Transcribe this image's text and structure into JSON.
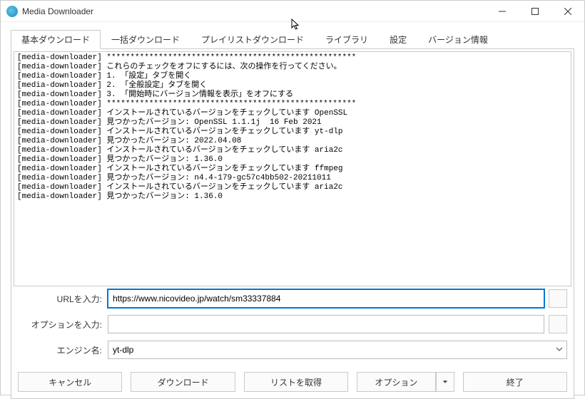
{
  "window": {
    "title": "Media Downloader"
  },
  "tabs": {
    "t0": "基本ダウンロード",
    "t1": "一括ダウンロード",
    "t2": "プレイリストダウンロード",
    "t3": "ライブラリ",
    "t4": "設定",
    "t5": "バージョン情報"
  },
  "log_lines": [
    "[media-downloader] *****************************************************",
    "[media-downloader] これらのチェックをオフにするには、次の操作を行ってください。",
    "[media-downloader] 1. 「設定」タブを開く",
    "[media-downloader] 2. 「全般設定」タブを開く",
    "[media-downloader] 3. 「開始時にバージョン情報を表示」をオフにする",
    "[media-downloader] *****************************************************",
    "[media-downloader] インストールされているバージョンをチェックしています OpenSSL",
    "[media-downloader] 見つかったバージョン: OpenSSL 1.1.1j  16 Feb 2021",
    "[media-downloader] インストールされているバージョンをチェックしています yt-dlp",
    "[media-downloader] 見つかったバージョン: 2022.04.08",
    "[media-downloader] インストールされているバージョンをチェックしています aria2c",
    "[media-downloader] 見つかったバージョン: 1.36.0",
    "[media-downloader] インストールされているバージョンをチェックしています ffmpeg",
    "[media-downloader] 見つかったバージョン: n4.4-179-gc57c4bb502-20211011",
    "[media-downloader] インストールされているバージョンをチェックしています aria2c",
    "[media-downloader] 見つかったバージョン: 1.36.0"
  ],
  "form": {
    "url_label": "URLを入力:",
    "url_value": "https://www.nicovideo.jp/watch/sm33337884",
    "options_label": "オプションを入力:",
    "options_value": "",
    "engine_label": "エンジン名:",
    "engine_value": "yt-dlp"
  },
  "buttons": {
    "cancel": "キャンセル",
    "download": "ダウンロード",
    "get_list": "リストを取得",
    "options": "オプション",
    "exit": "終了"
  }
}
